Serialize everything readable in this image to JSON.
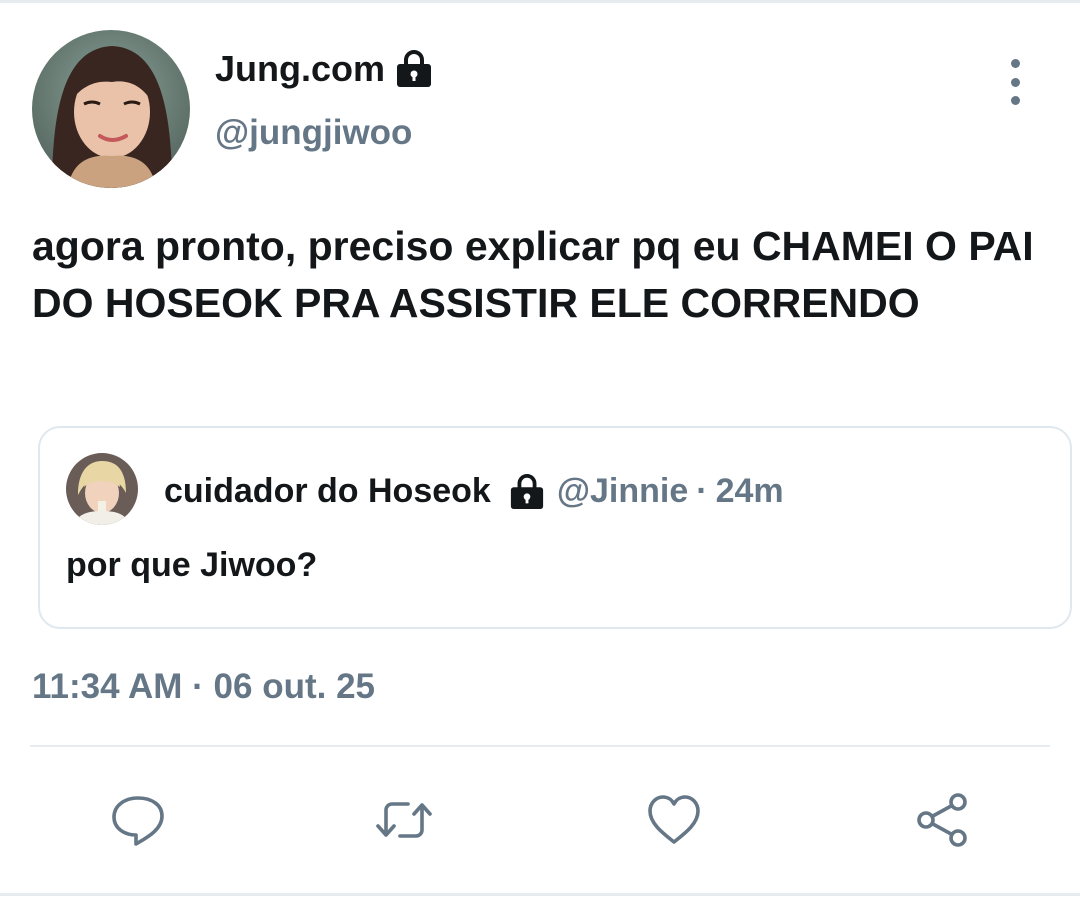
{
  "user": {
    "display_name": "Jung.com",
    "handle": "@jungjiwoo",
    "avatar_icon": "profile-photo",
    "locked": true
  },
  "tweet": {
    "text": "agora pronto, preciso explicar pq eu CHAMEI O PAI DO HOSEOK PRA ASSISTIR ELE CORRENDO",
    "timestamp": "11:34 AM · 06 out. 25"
  },
  "quoted": {
    "display_name": "cuidador do Hoseok",
    "handle": "@Jinnie",
    "separator": "·",
    "time": "24m",
    "text": "por que Jiwoo?",
    "locked": true
  },
  "actions": [
    {
      "icon": "reply-icon"
    },
    {
      "icon": "retweet-icon"
    },
    {
      "icon": "like-icon"
    },
    {
      "icon": "share-icon"
    }
  ],
  "colors": {
    "text_primary": "#14171a",
    "text_secondary": "#657786",
    "border": "#e1e8ed"
  }
}
